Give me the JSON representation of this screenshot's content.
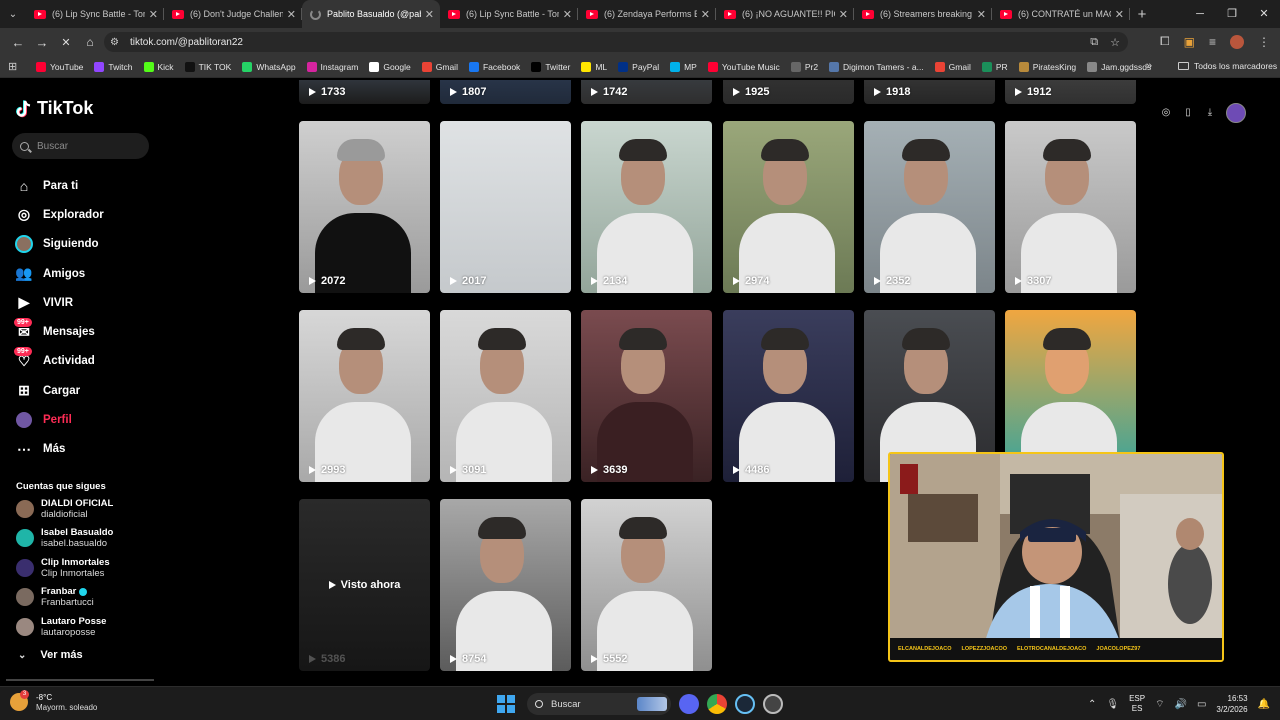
{
  "browser": {
    "tabs": [
      {
        "title": "(6) Lip Sync Battle - Tom H",
        "kind": "youtube",
        "active": false
      },
      {
        "title": "(6) Don't Judge Challenge",
        "kind": "youtube",
        "active": false
      },
      {
        "title": "Pablito Basualdo (@pablito",
        "kind": "loading",
        "active": true
      },
      {
        "title": "(6) Lip Sync Battle - Tom H",
        "kind": "youtube",
        "active": false
      },
      {
        "title": "(6) Zendaya Performs Bru",
        "kind": "youtube",
        "active": false
      },
      {
        "title": "(6) ¡NO AGUANTE!! PICA",
        "kind": "youtube",
        "active": false
      },
      {
        "title": "(6) Streamers breaking th",
        "kind": "youtube",
        "active": false
      },
      {
        "title": "(6) CONTRATÉ un MAGO",
        "kind": "youtube",
        "active": false
      }
    ],
    "url": "tiktok.com/@pablitoran22",
    "bookmarks": [
      {
        "label": "YouTube",
        "color": "#ff0033"
      },
      {
        "label": "Twitch",
        "color": "#9146ff"
      },
      {
        "label": "Kick",
        "color": "#53fc18"
      },
      {
        "label": "TIK TOK",
        "color": "#111111"
      },
      {
        "label": "WhatsApp",
        "color": "#25d366"
      },
      {
        "label": "Instagram",
        "color": "#d6249f"
      },
      {
        "label": "Google",
        "color": "#ffffff"
      },
      {
        "label": "Gmail",
        "color": "#ea4335"
      },
      {
        "label": "Facebook",
        "color": "#1877f2"
      },
      {
        "label": "Twitter",
        "color": "#000000"
      },
      {
        "label": "ML",
        "color": "#ffe600"
      },
      {
        "label": "PayPal",
        "color": "#003087"
      },
      {
        "label": "MP",
        "color": "#00b1ea"
      },
      {
        "label": "YouTube Music",
        "color": "#ff0033"
      },
      {
        "label": "Pr2",
        "color": "#666666"
      },
      {
        "label": "Digimon Tamers - a...",
        "color": "#5577aa"
      },
      {
        "label": "Gmail",
        "color": "#ea4335"
      },
      {
        "label": "PR",
        "color": "#1b8f5a"
      },
      {
        "label": "PiratesKing",
        "color": "#b88a3b"
      },
      {
        "label": "Jam.ggdssds",
        "color": "#888888"
      }
    ],
    "all_bookmarks": "Todos los marcadores"
  },
  "tiktok": {
    "logo": "TikTok",
    "search_placeholder": "Buscar",
    "nav": [
      {
        "label": "Para ti",
        "icon": "home-icon"
      },
      {
        "label": "Explorador",
        "icon": "compass-icon"
      },
      {
        "label": "Siguiendo",
        "icon": "following-avatar-icon"
      },
      {
        "label": "Amigos",
        "icon": "friends-icon"
      },
      {
        "label": "VIVIR",
        "icon": "live-icon"
      },
      {
        "label": "Mensajes",
        "icon": "messages-icon",
        "badge": "99+"
      },
      {
        "label": "Actividad",
        "icon": "activity-icon",
        "badge": "99+"
      },
      {
        "label": "Cargar",
        "icon": "upload-icon"
      },
      {
        "label": "Perfil",
        "icon": "profile-icon"
      },
      {
        "label": "Más",
        "icon": "more-icon"
      }
    ],
    "following_heading": "Cuentas que sigues",
    "following": [
      {
        "name": "DIALDI OFICIAL",
        "handle": "dialdioficial",
        "color": "#8a6a55",
        "verified": false
      },
      {
        "name": "Isabel Basualdo",
        "handle": "isabel.basualdo",
        "color": "#1fb5a8",
        "verified": false
      },
      {
        "name": "Clip Inmortales",
        "handle": "Clip Inmortales",
        "color": "#3a2e6e",
        "verified": false
      },
      {
        "name": "Franbar",
        "handle": "Franbartucci",
        "color": "#7a6a60",
        "verified": true
      },
      {
        "name": "Lautaro Posse",
        "handle": "lautaroposse",
        "color": "#9a8880",
        "verified": false
      }
    ],
    "see_more": "Ver más",
    "videos": [
      {
        "views": "1733"
      },
      {
        "views": "1807"
      },
      {
        "views": "1742"
      },
      {
        "views": "1925"
      },
      {
        "views": "1918"
      },
      {
        "views": "1912"
      },
      {
        "views": "2072"
      },
      {
        "views": "2017"
      },
      {
        "views": "2134"
      },
      {
        "views": "2974"
      },
      {
        "views": "2352"
      },
      {
        "views": "3307"
      },
      {
        "views": "2993"
      },
      {
        "views": "3091"
      },
      {
        "views": "3639"
      },
      {
        "views": "4486"
      },
      {
        "views": ""
      },
      {
        "views": ""
      },
      {
        "views": "5386",
        "overlay": "Visto ahora"
      },
      {
        "views": "8754"
      },
      {
        "views": "5552"
      }
    ]
  },
  "webcam": {
    "footer": [
      "ELCANALDEJOACO",
      "LOPEZZJOACOO",
      "ELOTROCANALDEJOACO",
      "JOACOLOPEZ97"
    ]
  },
  "taskbar": {
    "temp": "-8°C",
    "weather": "Mayorm. soleado",
    "weather_badge": "3",
    "search": "Buscar",
    "lang_top": "ESP",
    "lang_bottom": "ES",
    "time": "16:53",
    "date": "3/2/2026"
  }
}
